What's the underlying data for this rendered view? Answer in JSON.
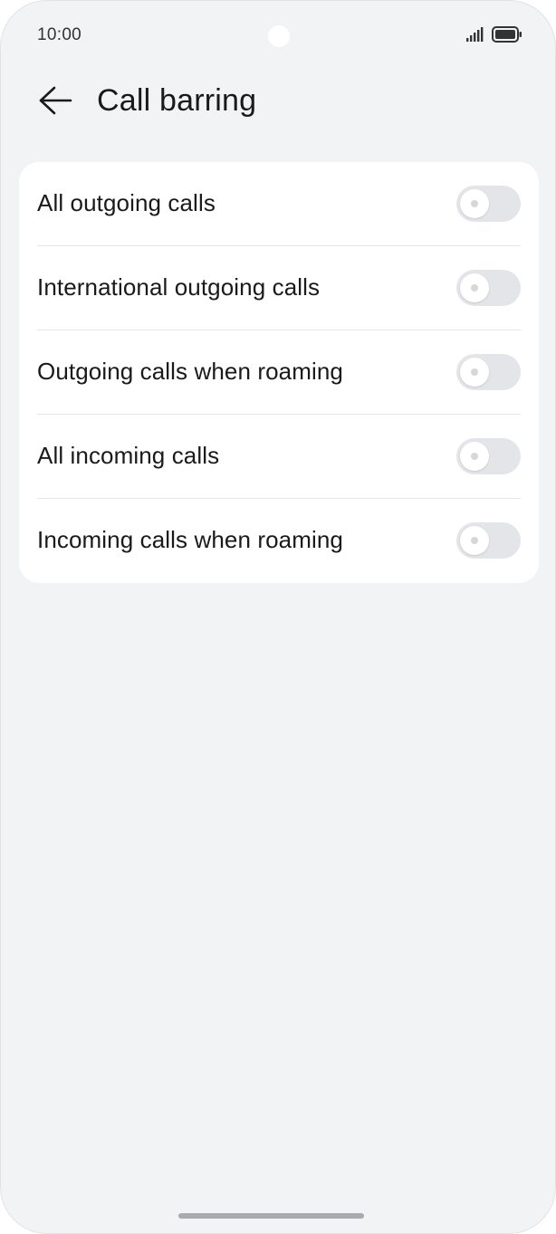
{
  "status_bar": {
    "time": "10:00",
    "signal_icon": "cellular-signal-icon",
    "battery_icon": "battery-full-icon"
  },
  "header": {
    "back_icon": "back-arrow-icon",
    "title": "Call barring"
  },
  "settings": {
    "items": [
      {
        "label": "All outgoing calls",
        "enabled": false
      },
      {
        "label": "International outgoing calls",
        "enabled": false
      },
      {
        "label": "Outgoing calls when roaming",
        "enabled": false
      },
      {
        "label": "All incoming calls",
        "enabled": false
      },
      {
        "label": "Incoming calls when roaming",
        "enabled": false
      }
    ]
  },
  "colors": {
    "background": "#f2f3f5",
    "card": "#ffffff",
    "toggle_off_track": "#e4e5e8",
    "text_primary": "#1a1a1a"
  }
}
